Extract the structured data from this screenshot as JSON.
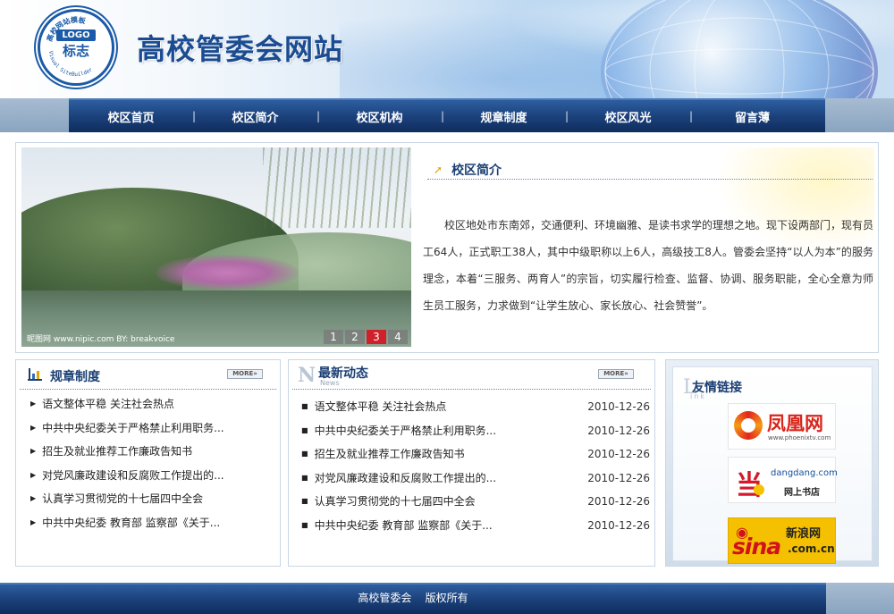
{
  "header": {
    "site_title": "高校管委会网站",
    "logo": {
      "word": "LOGO",
      "cn": "标志",
      "ring_top": "高校网站模板",
      "ring_bottom": "Visual SiteBuilder"
    }
  },
  "nav": {
    "items": [
      "校区首页",
      "校区简介",
      "校区机构",
      "规章制度",
      "校区风光",
      "留言薄"
    ],
    "separator": "|"
  },
  "banner": {
    "caption": "昵图网 www.nipic.com  BY: breakvoice",
    "pages": [
      "1",
      "2",
      "3",
      "4"
    ],
    "active_page": "3"
  },
  "intro": {
    "title": "校区简介",
    "text": "校区地处市东南郊，交通便利、环境幽雅、是读书求学的理想之地。现下设两部门，现有员工64人，正式职工38人，其中中级职称以上6人，高级技工8人。管委会坚持“以人为本”的服务理念，本着“三服务、两育人”的宗旨，切实履行检查、监督、协调、服务职能，全心全意为师生员工服务，力求做到“让学生放心、家长放心、社会赞誉”。"
  },
  "rules": {
    "title": "规章制度",
    "more": "MORE»",
    "items": [
      "语文整体平稳 关注社会热点",
      "中共中央纪委关于严格禁止利用职务...",
      "招生及就业推荐工作廉政告知书",
      "对党风廉政建设和反腐败工作提出的...",
      "认真学习贯彻党的十七届四中全会",
      "中共中央纪委 教育部 监察部《关于..."
    ]
  },
  "news": {
    "letter": "N",
    "title": "最新动态",
    "subtitle": "News",
    "more": "MORE»",
    "items": [
      {
        "title": "语文整体平稳 关注社会热点",
        "date": "2010-12-26"
      },
      {
        "title": "中共中央纪委关于严格禁止利用职务...",
        "date": "2010-12-26"
      },
      {
        "title": "招生及就业推荐工作廉政告知书",
        "date": "2010-12-26"
      },
      {
        "title": "对党风廉政建设和反腐败工作提出的...",
        "date": "2010-12-26"
      },
      {
        "title": "认真学习贯彻党的十七届四中全会",
        "date": "2010-12-26"
      },
      {
        "title": "中共中央纪委 教育部 监察部《关于...",
        "date": "2010-12-26"
      }
    ]
  },
  "links": {
    "letter": "L",
    "title": "友情链接",
    "subtitle": "ink",
    "ifeng": {
      "name": "凤凰网",
      "url": "www.phoenixtv.com"
    },
    "dangdang": {
      "mark": "当",
      "url": "dangdang.com",
      "name": "网上书店"
    },
    "sina": {
      "word": "sina",
      "cn": "新浪网",
      "domain": ".com.cn"
    }
  },
  "footer": {
    "text": "高校管委会    版权所有"
  },
  "colors": {
    "nav_blue": "#1a3f78",
    "title_blue": "#1b4c92",
    "active_red": "#d0202a",
    "accent_orange": "#e5a400"
  },
  "icons": [
    "intro-arrow-icon",
    "rules-chart-icon",
    "bullet-icon",
    "ifeng-swirl-icon",
    "sina-eye-icon"
  ]
}
